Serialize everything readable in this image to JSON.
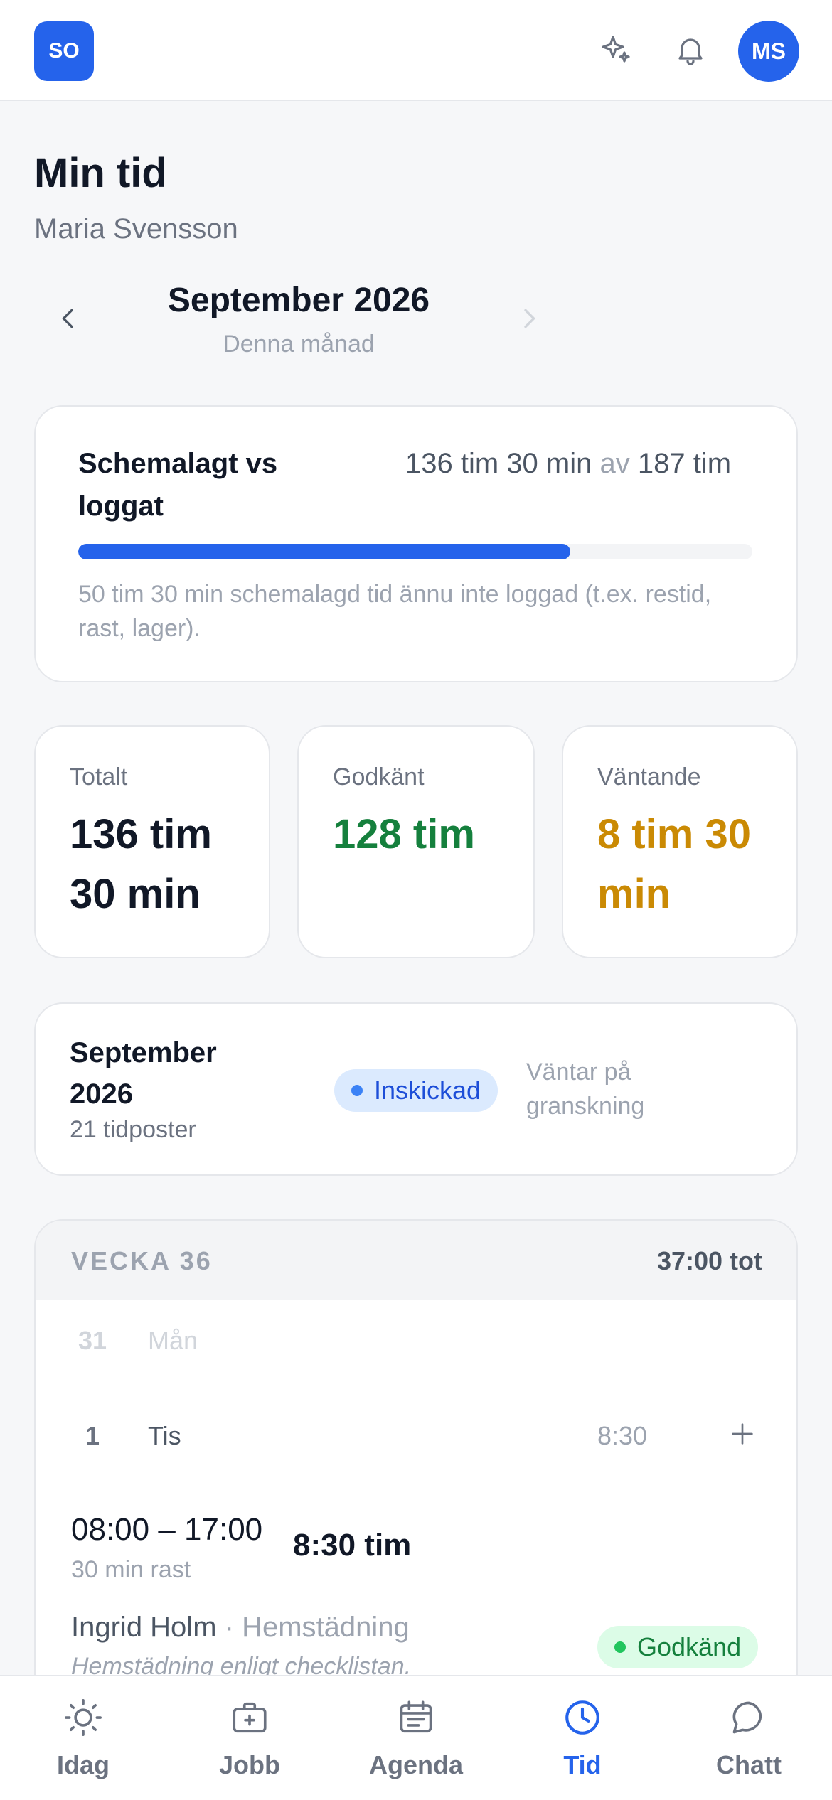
{
  "header": {
    "logo_text": "SO",
    "sparkle_icon": "sparkle-icon",
    "bell_icon": "bell-icon",
    "avatar_initials": "MS"
  },
  "page": {
    "title": "Min tid",
    "user_name": "Maria Svensson"
  },
  "month_nav": {
    "month": "September 2026",
    "subtitle": "Denna månad"
  },
  "scheduled": {
    "label": "Schemalagt vs loggat",
    "logged": "136 tim 30 min",
    "of": "av",
    "scheduled": "187 tim",
    "progress_fraction": 0.73,
    "note": "50 tim 30 min schemalagd tid ännu inte loggad (t.ex. restid, rast, lager)."
  },
  "stats": [
    {
      "label": "Totalt",
      "value": "136 tim 30 min",
      "color": "#111827"
    },
    {
      "label": "Godkänt",
      "value": "128 tim",
      "color": "#15803d"
    },
    {
      "label": "Väntande",
      "value": "8 tim 30 min",
      "color": "#ca8a04"
    }
  ],
  "period": {
    "title": "September 2026",
    "entries": "21 tidposter",
    "badge": "Inskickad",
    "status": "Väntar på granskning"
  },
  "week": {
    "label": "VECKA 36",
    "total": "37:00 tot",
    "days": [
      {
        "num": "31",
        "name": "Mån",
        "hours": ""
      },
      {
        "num": "1",
        "name": "Tis",
        "hours": "8:30"
      }
    ],
    "entry": {
      "time": "08:00 – 17:00",
      "break": "30 min rast",
      "duration": "8:30 tim",
      "client": "Ingrid Holm",
      "separator": " · ",
      "service": "Hemstädning",
      "description": "Hemstädning enligt checklistan.",
      "status": "Godkänd"
    }
  },
  "bottom_nav": [
    {
      "label": "Idag",
      "icon": "sun-icon"
    },
    {
      "label": "Jobb",
      "icon": "briefcase-icon"
    },
    {
      "label": "Agenda",
      "icon": "calendar-icon"
    },
    {
      "label": "Tid",
      "icon": "clock-icon",
      "active": true
    },
    {
      "label": "Chatt",
      "icon": "chat-icon"
    }
  ],
  "colors": {
    "accent": "#2563eb",
    "approved": "#15803d",
    "pending": "#ca8a04"
  }
}
